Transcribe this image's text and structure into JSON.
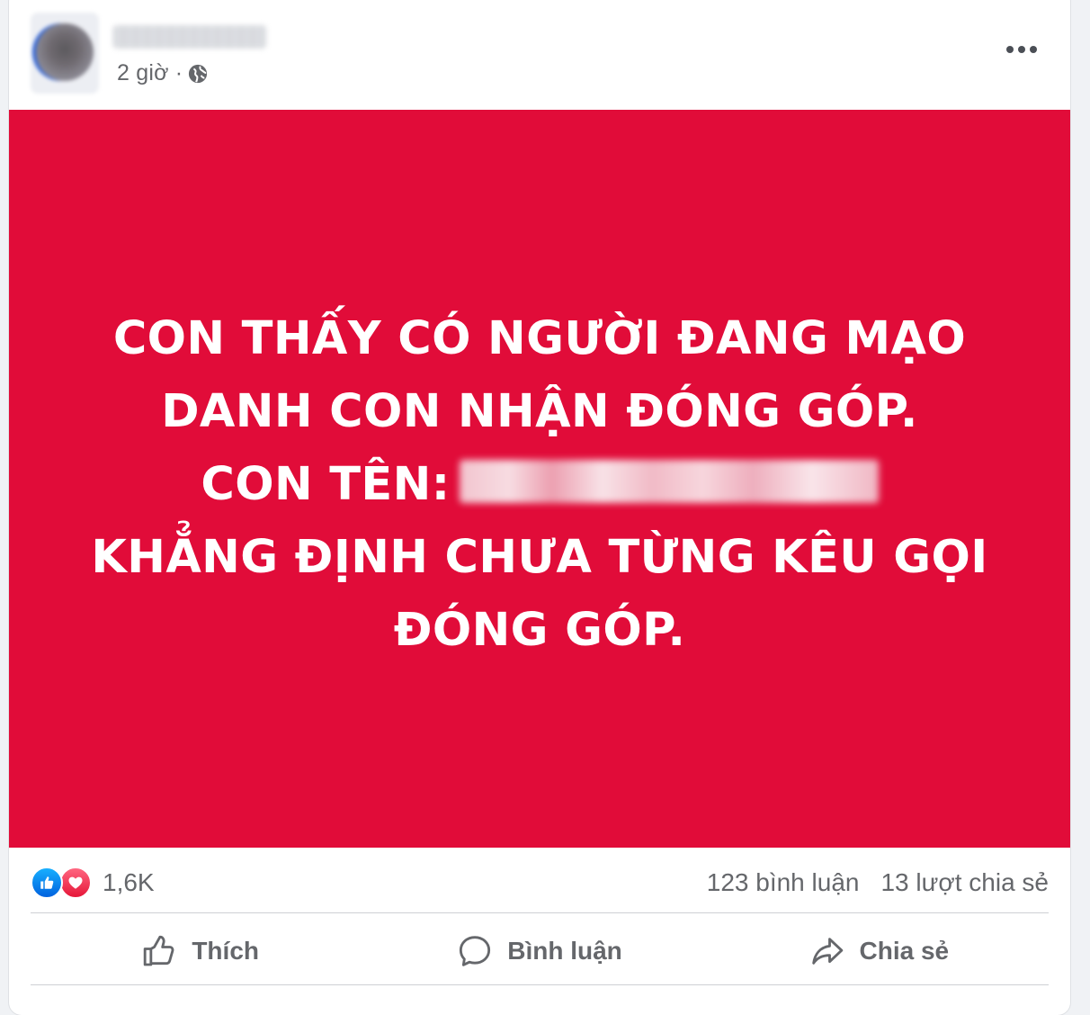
{
  "post": {
    "timestamp": "2 giờ",
    "separator": "·",
    "audience_icon": "globe-icon",
    "more_icon": "more-options-icon"
  },
  "image": {
    "background_color": "#e10c39",
    "text_color": "#ffffff",
    "lines": [
      "CON THẤY CÓ NGƯỜI ĐANG MẠO",
      "DANH CON NHẬN ĐÓNG GÓP.",
      "CON TÊN:",
      "KHẲNG ĐỊNH CHƯA TỪNG KÊU GỌI",
      "ĐÓNG GÓP."
    ]
  },
  "stats": {
    "reactions": [
      "like-icon",
      "love-icon"
    ],
    "reaction_count": "1,6K",
    "comments": "123 bình luận",
    "shares": "13 lượt chia sẻ"
  },
  "actions": {
    "like": "Thích",
    "comment": "Bình luận",
    "share": "Chia sẻ"
  },
  "colors": {
    "like_blue": "#0866ff",
    "love_red": "#f33e58",
    "secondary_text": "#65676b"
  }
}
